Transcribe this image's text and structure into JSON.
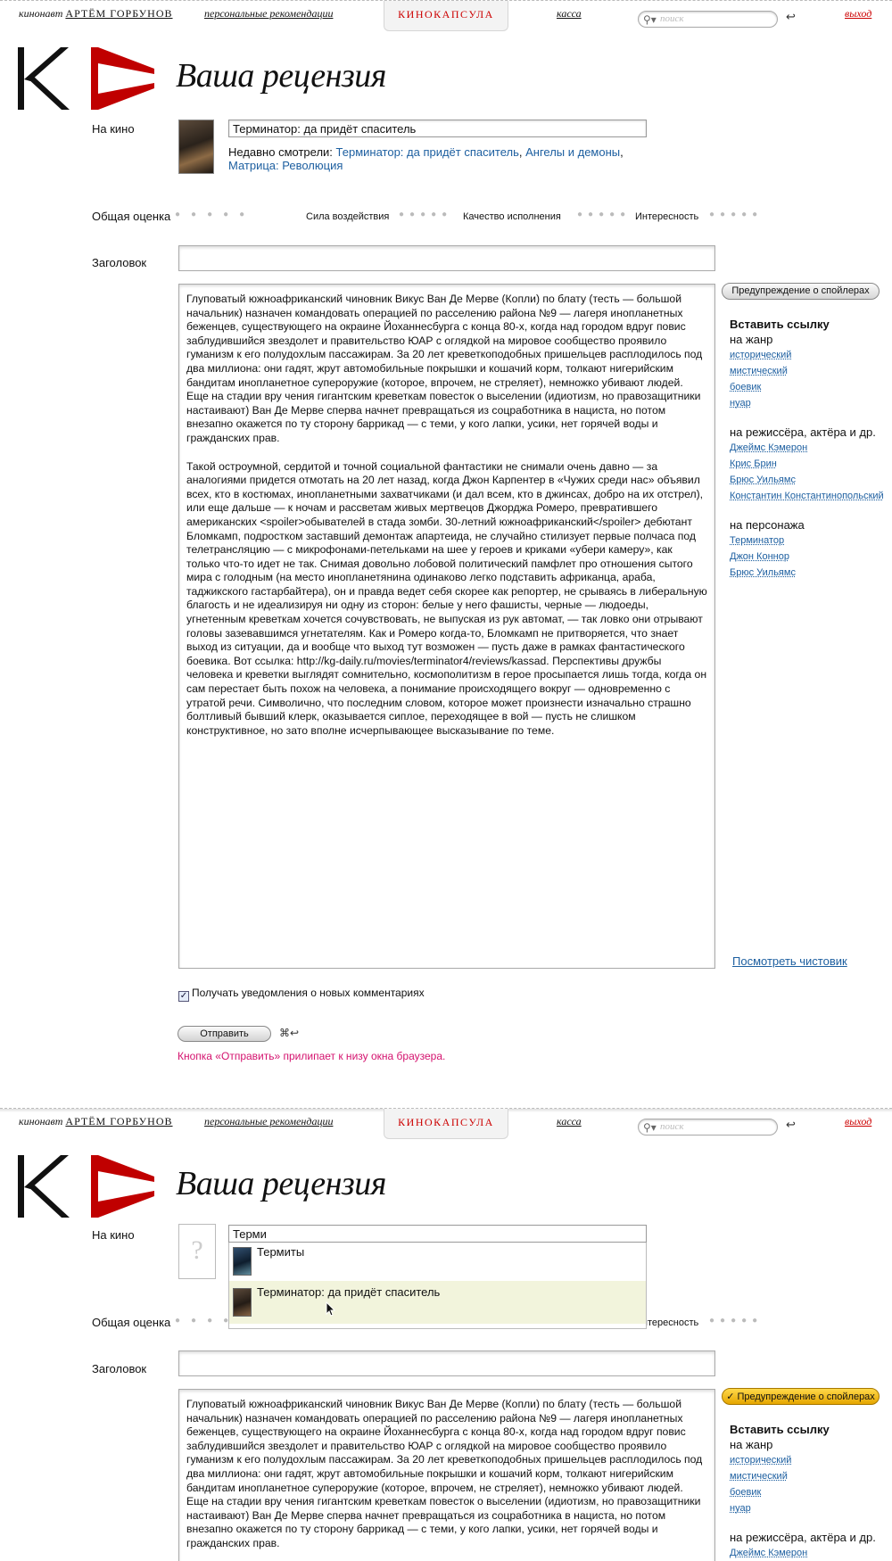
{
  "header": {
    "author_prefix": "кинонавт",
    "author_name": "АРТЁМ ГОРБУНОВ",
    "recommendations": "персональные рекомендации",
    "kinokapsula": "КИНОКАПСУЛА",
    "kassa": "касса",
    "search_placeholder": "поиск",
    "logout": "выход"
  },
  "page_title": "Ваша рецензия",
  "form": {
    "film_label": "На кино",
    "film_value": "Терминатор: да придёт спаситель",
    "recent_label": "Недавно смотрели:",
    "recent_films": [
      "Терминатор: да придёт спаситель",
      "Ангелы и демоны",
      "Матрица: Революция"
    ],
    "overall_rating_label": "Общая оценка",
    "impact_label": "Сила воздействия",
    "quality_label": "Качество исполнения",
    "interest_label": "Интересность",
    "headline_label": "Заголовок",
    "review_p1": "Глуповатый южноафриканский чиновник Викус Ван Де Мерве (Копли) по блату (тесть — большой начальник) назначен командовать операцией по расселению района №9 — лагеря инопланетных беженцев, существующего на окраине Йоханнесбурга с конца 80-х, когда над городом вдруг повис заблудившийся звездолет и правительство ЮАР с оглядкой на мировое сообщество проявило гуманизм к его полудохлым пассажирам. За 20 лет креветкоподобных пришельцев расплодилось под два миллиона: они гадят, жрут автомобильные покрышки и кошачий корм, толкают нигерийским бандитам инопланетное супероружие (которое, впрочем, не стреляет), немножко убивают людей. Еще на стадии вру чения гигантским креветкам повесток о выселении (идиотизм, но правозащитники настаивают) Ван Де Мерве сперва начнет превращаться из соцработника в нациста, но потом внезапно окажется по ту сторону баррикад — с теми, у кого лапки, усики, нет горячей воды и гражданских прав.",
    "review_p2": "Такой остроумной, сердитой и точной социальной фантастики не снимали очень давно — за аналогиями придется отмотать на 20 лет назад, когда Джон Карпентер в «Чужих среди нас» объявил всех, кто в костюмах, инопланетными захватчиками (и дал всем, кто в джинсах, добро на их отстрел), или еще дальше — к ночам и рассветам живых мертвецов Джорджа Ромеро, превратившего американских <spoiler>обывателей в стада зомби. 30-летний южноафриканский</spoiler> дебютант Бломкамп, подростком заставший демонтаж апартеида, не случайно стилизует первые полчаса под телетрансляцию — с микрофонами-петельками на шее у героев и криками «убери камеру», как только что-то идет не так. Снимая довольно лобовой политический памфлет про отношения сытого мира с голодным (на место инопланетянина одинаково легко подставить африканца, араба, таджикского гастарбайтера), он и правда ведет себя скорее как репортер, не срываясь в либеральную благость и не идеализируя ни одну из сторон: белые у него фашисты, черные — людоеды, угнетенным креветкам хочется сочувствовать, не выпуская из рук автомат, — так ловко они отрывают головы зазевавшимся угнетателям. Как и Ромеро когда-то, Бломкамп не притворяется, что знает выход из ситуации, да и вообще что выход тут возможен — пусть даже в рамках фантастического боевика. Вот ссылка: http://kg-daily.ru/movies/terminator4/reviews/kassad. Перспективы дружбы человека и креветки выглядят сомнительно, космополитизм в герое просыпается лишь тогда, когда он сам перестает быть похож на человека, а понимание происходящего вокруг — одновременно с утратой речи. Символично, что последним словом, которое может произнести изначально страшно болтливый бывший клерк, оказывается сиплое, переходящее в вой — пусть не слишком конструктивное, но зато вполне исчерпывающее высказывание по теме.",
    "preview_link": "Посмотреть чистовик",
    "notify_label": "Получать уведомления о новых комментариях",
    "notify_checked": true,
    "submit_label": "Отправить",
    "shortcut": "⌘↩",
    "hint": "Кнопка «Отправить» прилипает к низу окна браузера."
  },
  "sidebar": {
    "spoiler_button": "Предупреждение о спойлерах",
    "spoiler_button_active": "✓ Предупреждение о спойлерах",
    "insert_link": "Вставить ссылку",
    "genre_label": "на жанр",
    "genres": [
      "исторический",
      "мистический",
      "боевик",
      "нуар"
    ],
    "people_label": "на режиссёра, актёра и др.",
    "people": [
      "Джеймс Кэмерон",
      "Крис Брин",
      "Брюс Уильямс",
      "Константин Константинопольский"
    ],
    "character_label": "на персонажа",
    "characters": [
      "Терминатор",
      "Джон Коннор",
      "Брюс Уильямс"
    ]
  },
  "autocomplete": {
    "query": "Терми",
    "results": [
      "Термиты",
      "Терминатор: да придёт спаситель"
    ],
    "highlighted_index": 1
  },
  "colors": {
    "link": "#1d5fa0",
    "logo_red": "#c00000",
    "hint": "#d4126e",
    "highlight_row": "#f2f4dc",
    "spoiler_active": "#f0b800"
  }
}
